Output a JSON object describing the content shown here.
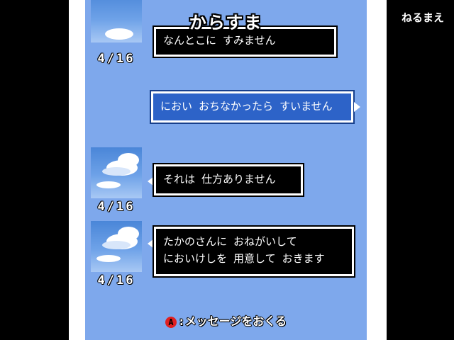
{
  "header": {
    "title": "からすま",
    "top_right_label": "ねるまえ"
  },
  "messages": [
    {
      "sender": "other",
      "text": "なんとこに すみません",
      "date": "4/16"
    },
    {
      "sender": "me",
      "text": "におい おちなかったら すいません"
    },
    {
      "sender": "other",
      "text": "それは 仕方ありません",
      "date": "4/16"
    },
    {
      "sender": "other",
      "text": "たかのさんに おねがいして\nにおいけしを 用意して おきます",
      "date": "4/16"
    }
  ],
  "footer": {
    "button_label": "A",
    "hint_text": ":メッセージをおくる"
  },
  "colors": {
    "panel": "#7ea8ec",
    "bubble_other": "#000000",
    "bubble_me": "#2d63c8",
    "a_button": "#e02020"
  }
}
